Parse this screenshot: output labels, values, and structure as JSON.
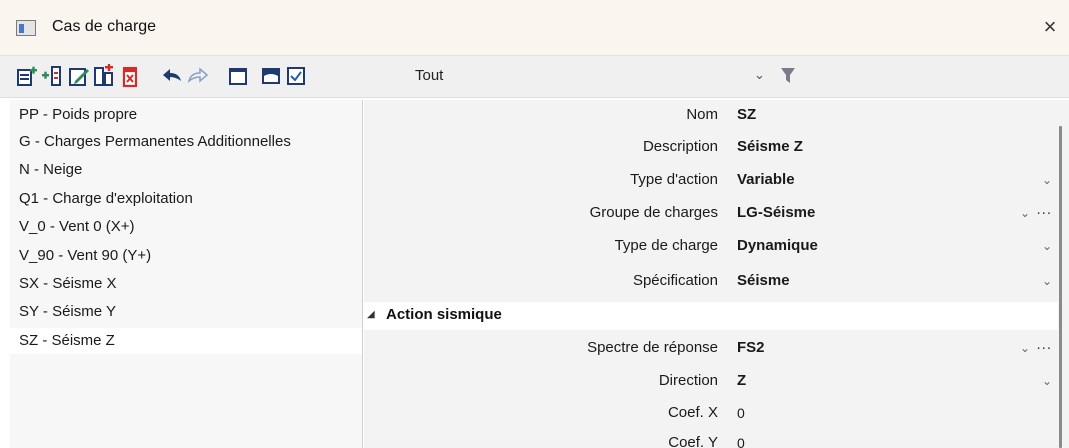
{
  "window": {
    "title": "Cas de charge",
    "close_icon": "×"
  },
  "toolbar": {
    "buttons": [
      "new-icon",
      "insert-icon",
      "edit-icon",
      "copy-icon",
      "delete-icon",
      "undo-icon",
      "redo-icon",
      "table-icon",
      "save-icon",
      "check-icon"
    ],
    "filter_label": "Tout",
    "filter_chevron": "⌄",
    "colors": {
      "green": "#2e8b57",
      "blue": "#1f5fbf",
      "red": "#d42a2a",
      "navy": "#1e3a6e"
    }
  },
  "load_cases": [
    {
      "label": "PP - Poids propre",
      "selected": false
    },
    {
      "label": "G - Charges Permanentes Additionnelles",
      "selected": false
    },
    {
      "label": "N - Neige",
      "selected": false
    },
    {
      "label": "Q1 - Charge d'exploitation",
      "selected": false
    },
    {
      "label": "V_0 - Vent 0 (X+)",
      "selected": false
    },
    {
      "label": "V_90 - Vent 90 (Y+)",
      "selected": false
    },
    {
      "label": "SX - Séisme X",
      "selected": false
    },
    {
      "label": "SY - Séisme Y",
      "selected": false
    },
    {
      "label": "SZ - Séisme Z",
      "selected": true
    }
  ],
  "properties": {
    "nom": {
      "label": "Nom",
      "value": "SZ"
    },
    "description": {
      "label": "Description",
      "value": "Séisme Z"
    },
    "type_action": {
      "label": "Type d'action",
      "value": "Variable"
    },
    "groupe_charges": {
      "label": "Groupe de charges",
      "value": "LG-Séisme"
    },
    "type_charge": {
      "label": "Type de charge",
      "value": "Dynamique"
    },
    "specification": {
      "label": "Spécification",
      "value": "Séisme"
    }
  },
  "section": {
    "title": "Action sismique",
    "spectre": {
      "label": "Spectre de réponse",
      "value": "FS2"
    },
    "direction": {
      "label": "Direction",
      "value": "Z"
    },
    "coef_x": {
      "label": "Coef. X",
      "value": "0"
    },
    "coef_y": {
      "label": "Coef. Y",
      "value": "0"
    }
  },
  "glyphs": {
    "chevron": "⌄",
    "dots": "...",
    "collapse": "◢"
  }
}
